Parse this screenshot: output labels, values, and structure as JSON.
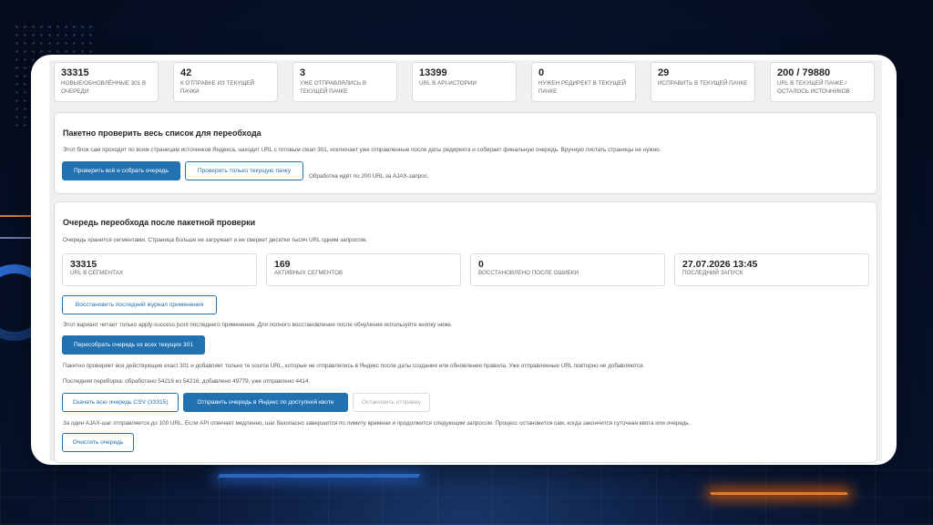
{
  "stats": [
    {
      "value": "33315",
      "label": "НОВЫЕ/ОБНОВЛЁННЫЕ 301 В ОЧЕРЕДИ"
    },
    {
      "value": "42",
      "label": "К ОТПРАВКЕ ИЗ ТЕКУЩЕЙ ПАЧКИ"
    },
    {
      "value": "3",
      "label": "УЖЕ ОТПРАВЛЯЛИСЬ В ТЕКУЩЕЙ ПАЧКЕ"
    },
    {
      "value": "13399",
      "label": "URL В API-ИСТОРИИ"
    },
    {
      "value": "0",
      "label": "НУЖЕН РЕДИРЕКТ В ТЕКУЩЕЙ ПАЧКЕ"
    },
    {
      "value": "29",
      "label": "ИСПРАВИТЬ В ТЕКУЩЕЙ ПАЧКЕ"
    },
    {
      "value": "200 / 79880",
      "label": "URL В ТЕКУЩЕЙ ПАЧКЕ / ОСТАЛОСЬ ИСТОЧНИКОВ"
    }
  ],
  "batch": {
    "title": "Пакетно проверить весь список для переобхода",
    "description": "Этот блок сам проходит по всем страницам источников Яндекса, находит URL с готовым clean 301, исключает уже отправленные после даты редиректа и собирает финальную очередь. Вручную листать страницы не нужно.",
    "check_all_label": "Проверить всё и собрать очередь",
    "check_current_label": "Проверить только текущую пачку",
    "note": "Обработка идёт по 200 URL за AJAX-запрос."
  },
  "queue": {
    "title": "Очередь переобхода после пакетной проверки",
    "description": "Очередь хранится сегментами. Страница больше не загружает и не сверяет десятки тысяч URL одним запросом.",
    "stats": [
      {
        "value": "33315",
        "label": "URL В СЕГМЕНТАХ"
      },
      {
        "value": "169",
        "label": "АКТИВНЫХ СЕГМЕНТОВ"
      },
      {
        "value": "0",
        "label": "ВОССТАНОВЛЕНО ПОСЛЕ ОШИБКИ"
      },
      {
        "value": "27.07.2026 13:45",
        "label": "ПОСЛЕДНИЙ ЗАПУСК"
      }
    ],
    "restore_label": "Восстановить последний журнал применения",
    "restore_note": "Этот вариант читает только apply-success.jsonl последнего применения. Для полного восстановления после обнуления используйте кнопку ниже.",
    "rebuild_label": "Пересобрать очередь из всех текущих 301",
    "rebuild_note": "Пакетно проверяет все действующие exact 301 и добавляет только те source URL, которые не отправлялись в Яндекс после даты создания или обновления правила. Уже отправленные URL повторно не добавляются.",
    "last_check": "Последняя переборка: обработано 54216 из 54216, добавлено 49779, уже отправлено 4414.",
    "download_label": "Скачать всю очередь CSV (33315)",
    "send_label": "Отправить очередь в Яндекс по доступной квоте",
    "stop_label": "Остановить отправку",
    "ajax_note": "За один AJAX-шаг отправляется до 100 URL. Если API отвечает медленно, шаг безопасно завершится по лимиту времени и продолжится следующим запросом. Процесс остановится сам, когда закончится суточная квота или очередь.",
    "clear_label": "Очистить очередь"
  }
}
